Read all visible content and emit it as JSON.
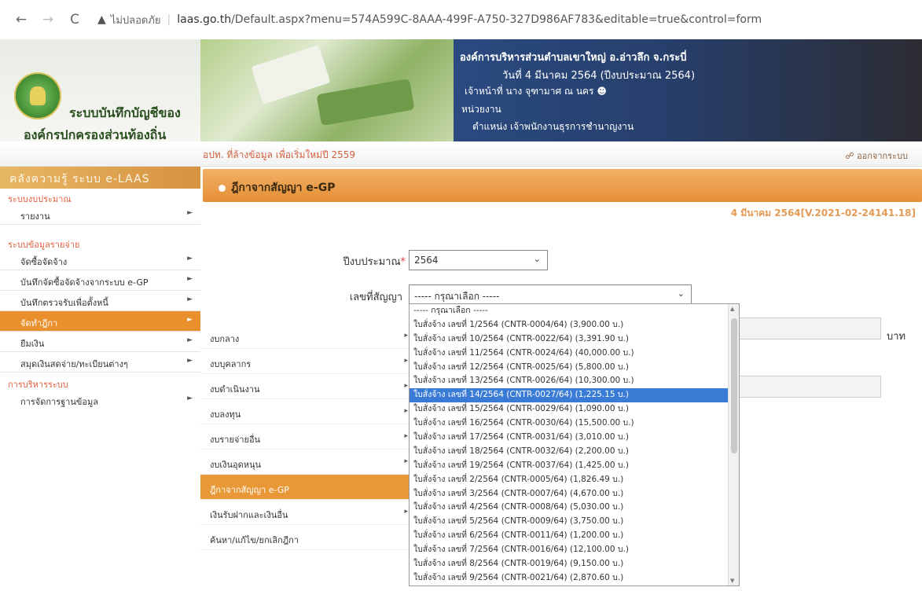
{
  "browser": {
    "back": "←",
    "forward": "→",
    "reload": "C",
    "security_label": "ไม่ปลอดภัย",
    "url_host": "laas.go.th",
    "url_path": "/Default.aspx?menu=574A599C-8AAA-499F-A750-327D986AF783&editable=true&control=form"
  },
  "header": {
    "logo_line1": "ระบบบันทึกบัญชีของ",
    "logo_line2": "องค์กรปกครองส่วนท้องถิ่น",
    "org": "องค์การบริหารส่วนตำบลเขาใหญ่ อ.อ่าวลึก จ.กระบี่",
    "date": "วันที่ 4 มีนาคม 2564  (ปีงบประมาณ 2564)",
    "officer": "เจ้าหน้าที่ นาง จุฑามาศ ณ นคร",
    "unit": "หน่วยงาน",
    "position": "ตำแหน่ง เจ้าพนักงานธุรการชำนาญงาน",
    "notice": "อปท. ที่ล้างข้อมูล เพื่อเริ่มใหม่ปี 2559",
    "logout": "ออกจากระบบ"
  },
  "sidebar": {
    "banner": "คลังความรู้ ระบบ e-LAAS",
    "section_budget": "ระบบงบประมาณ",
    "item_report": "รายงาน",
    "section_expense": "ระบบข้อมูลรายจ่าย",
    "item_procure": "จัดซื้อจัดจ้าง",
    "item_procure_egp": "บันทึกจัดซื้อจัดจ้างจากระบบ e-GP",
    "item_inspect": "บันทึกตรวจรับเพื่อตั้งหนี้",
    "item_debt": "จัดทำฎีกา",
    "item_loan": "ยืมเงิน",
    "item_cashbook": "สมุดเงินสดจ่าย/ทะเบียนต่างๆ",
    "section_admin": "การบริหารระบบ",
    "item_database": "การจัดการฐานข้อมูล"
  },
  "submenu": [
    "งบกลาง",
    "งบบุคลากร",
    "งบดำเนินงาน",
    "งบลงทุน",
    "งบรายจ่ายอื่น",
    "งบเงินอุดหนุน",
    "ฎีกาจากสัญญา e-GP",
    "เงินรับฝากและเงินอื่น",
    "ค้นหา/แก้ไข/ยกเลิกฎีกา"
  ],
  "main": {
    "title": "ฎีกาจากสัญญา e-GP",
    "stamp": "4 มีนาคม 2564[V.2021-02-24141.18]",
    "fiscal_label": "ปีงบประมาณ",
    "required_mark": "*",
    "fiscal_value": "2564",
    "contract_label": "เลขที่สัญญา",
    "contract_value": "----- กรุณาเลือก -----",
    "baht": "บาท"
  },
  "dropdown_options": [
    "----- กรุณาเลือก -----",
    "ใบสั่งจ้าง เลขที่ 1/2564 (CNTR-0004/64) (3,900.00 บ.)",
    "ใบสั่งจ้าง เลขที่ 10/2564 (CNTR-0022/64) (3,391.90 บ.)",
    "ใบสั่งจ้าง เลขที่ 11/2564 (CNTR-0024/64) (40,000.00 บ.)",
    "ใบสั่งจ้าง เลขที่ 12/2564 (CNTR-0025/64) (5,800.00 บ.)",
    "ใบสั่งจ้าง เลขที่ 13/2564 (CNTR-0026/64) (10,300.00 บ.)",
    "ใบสั่งจ้าง เลขที่ 14/2564 (CNTR-0027/64) (1,225.15 บ.)",
    "ใบสั่งจ้าง เลขที่ 15/2564 (CNTR-0029/64) (1,090.00 บ.)",
    "ใบสั่งจ้าง เลขที่ 16/2564 (CNTR-0030/64) (15,500.00 บ.)",
    "ใบสั่งจ้าง เลขที่ 17/2564 (CNTR-0031/64) (3,010.00 บ.)",
    "ใบสั่งจ้าง เลขที่ 18/2564 (CNTR-0032/64) (2,200.00 บ.)",
    "ใบสั่งจ้าง เลขที่ 19/2564 (CNTR-0037/64) (1,425.00 บ.)",
    "ใบสั่งจ้าง เลขที่ 2/2564 (CNTR-0005/64) (1,826.49 บ.)",
    "ใบสั่งจ้าง เลขที่ 3/2564 (CNTR-0007/64) (4,670.00 บ.)",
    "ใบสั่งจ้าง เลขที่ 4/2564 (CNTR-0008/64) (5,030.00 บ.)",
    "ใบสั่งจ้าง เลขที่ 5/2564 (CNTR-0009/64) (3,750.00 บ.)",
    "ใบสั่งจ้าง เลขที่ 6/2564 (CNTR-0011/64) (1,200.00 บ.)",
    "ใบสั่งจ้าง เลขที่ 7/2564 (CNTR-0016/64) (12,100.00 บ.)",
    "ใบสั่งจ้าง เลขที่ 8/2564 (CNTR-0019/64) (9,150.00 บ.)",
    "ใบสั่งจ้าง เลขที่ 9/2564 (CNTR-0021/64) (2,870.60 บ.)"
  ],
  "selected_index": 6,
  "colors": {
    "accent_orange": "#e58f36",
    "header_blue": "#2a4a80",
    "selection_blue": "#3a7cd5"
  }
}
